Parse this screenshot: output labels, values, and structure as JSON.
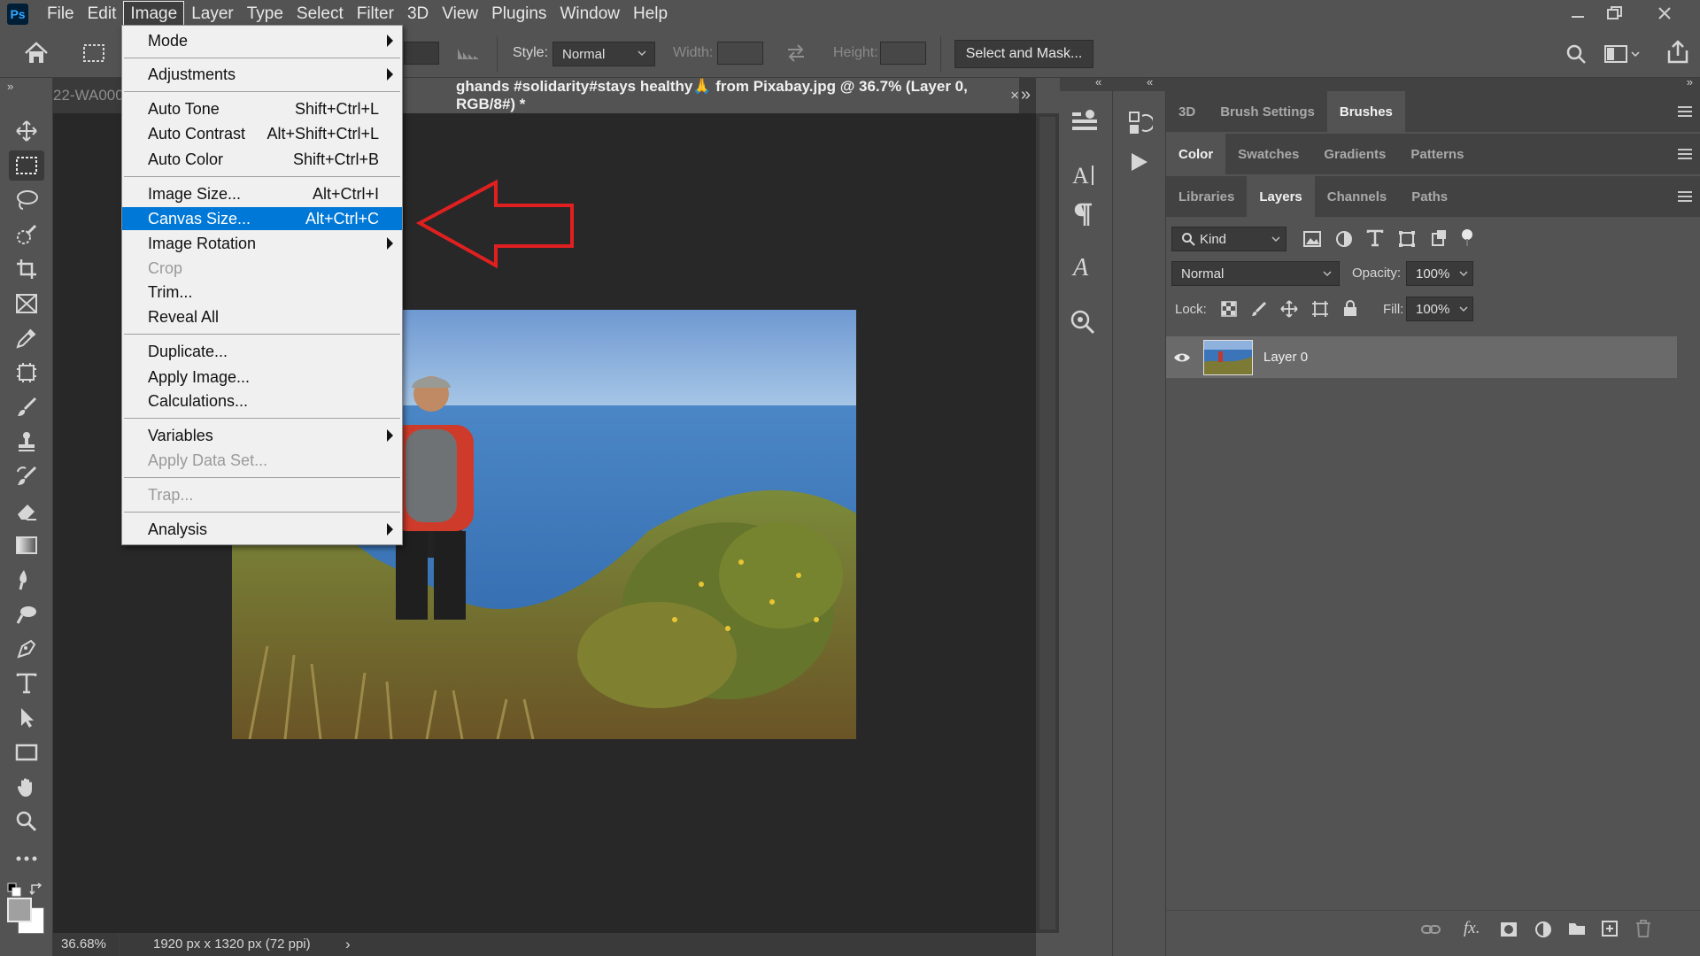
{
  "app": {
    "logo": "Ps"
  },
  "menubar": {
    "items": [
      "File",
      "Edit",
      "Image",
      "Layer",
      "Type",
      "Select",
      "Filter",
      "3D",
      "View",
      "Plugins",
      "Window",
      "Help"
    ],
    "active": "Image"
  },
  "options": {
    "style_label": "Style:",
    "style_value": "Normal",
    "width_label": "Width:",
    "height_label": "Height:",
    "select_mask": "Select and Mask..."
  },
  "tabs": {
    "prev_tab": "22-WA000",
    "active_tab": "ghands #solidarity#stays healthy🙏 from Pixabay.jpg @ 36.7% (Layer 0, RGB/8#) *",
    "close": "×",
    "overflow": "»"
  },
  "status": {
    "zoom": "36.68%",
    "doc_info": "1920 px x 1320 px (72 ppi)",
    "arrow": "›"
  },
  "image_menu": {
    "items": [
      {
        "label": "Mode",
        "shortcut": "",
        "submenu": true,
        "disabled": false
      },
      {
        "label": "Adjustments",
        "shortcut": "",
        "submenu": true,
        "disabled": false
      },
      {
        "label": "Auto Tone",
        "shortcut": "Shift+Ctrl+L",
        "submenu": false,
        "disabled": false
      },
      {
        "label": "Auto Contrast",
        "shortcut": "Alt+Shift+Ctrl+L",
        "submenu": false,
        "disabled": false
      },
      {
        "label": "Auto Color",
        "shortcut": "Shift+Ctrl+B",
        "submenu": false,
        "disabled": false
      },
      {
        "label": "Image Size...",
        "shortcut": "Alt+Ctrl+I",
        "submenu": false,
        "disabled": false
      },
      {
        "label": "Canvas Size...",
        "shortcut": "Alt+Ctrl+C",
        "submenu": false,
        "disabled": false,
        "highlighted": true
      },
      {
        "label": "Image Rotation",
        "shortcut": "",
        "submenu": true,
        "disabled": false
      },
      {
        "label": "Crop",
        "shortcut": "",
        "submenu": false,
        "disabled": true
      },
      {
        "label": "Trim...",
        "shortcut": "",
        "submenu": false,
        "disabled": false
      },
      {
        "label": "Reveal All",
        "shortcut": "",
        "submenu": false,
        "disabled": false
      },
      {
        "label": "Duplicate...",
        "shortcut": "",
        "submenu": false,
        "disabled": false
      },
      {
        "label": "Apply Image...",
        "shortcut": "",
        "submenu": false,
        "disabled": false
      },
      {
        "label": "Calculations...",
        "shortcut": "",
        "submenu": false,
        "disabled": false
      },
      {
        "label": "Variables",
        "shortcut": "",
        "submenu": true,
        "disabled": false
      },
      {
        "label": "Apply Data Set...",
        "shortcut": "",
        "submenu": false,
        "disabled": true
      },
      {
        "label": "Trap...",
        "shortcut": "",
        "submenu": false,
        "disabled": true
      },
      {
        "label": "Analysis",
        "shortcut": "",
        "submenu": true,
        "disabled": false
      }
    ]
  },
  "panels": {
    "group1_tabs": [
      "3D",
      "Brush Settings",
      "Brushes"
    ],
    "group1_active": "Brushes",
    "group2_tabs": [
      "Color",
      "Swatches",
      "Gradients",
      "Patterns"
    ],
    "group2_active": "Color",
    "group3_tabs": [
      "Libraries",
      "Layers",
      "Channels",
      "Paths"
    ],
    "group3_active": "Layers"
  },
  "layers": {
    "filter_kind": "Kind",
    "blend_mode": "Normal",
    "opacity_label": "Opacity:",
    "opacity_value": "100%",
    "lock_label": "Lock:",
    "fill_label": "Fill:",
    "fill_value": "100%",
    "layer_name": "Layer 0"
  },
  "colors": {
    "menu_highlight": "#0078d7",
    "arrow": "#e02020",
    "ui_bg": "#535353",
    "canvas_bg": "#282828"
  }
}
